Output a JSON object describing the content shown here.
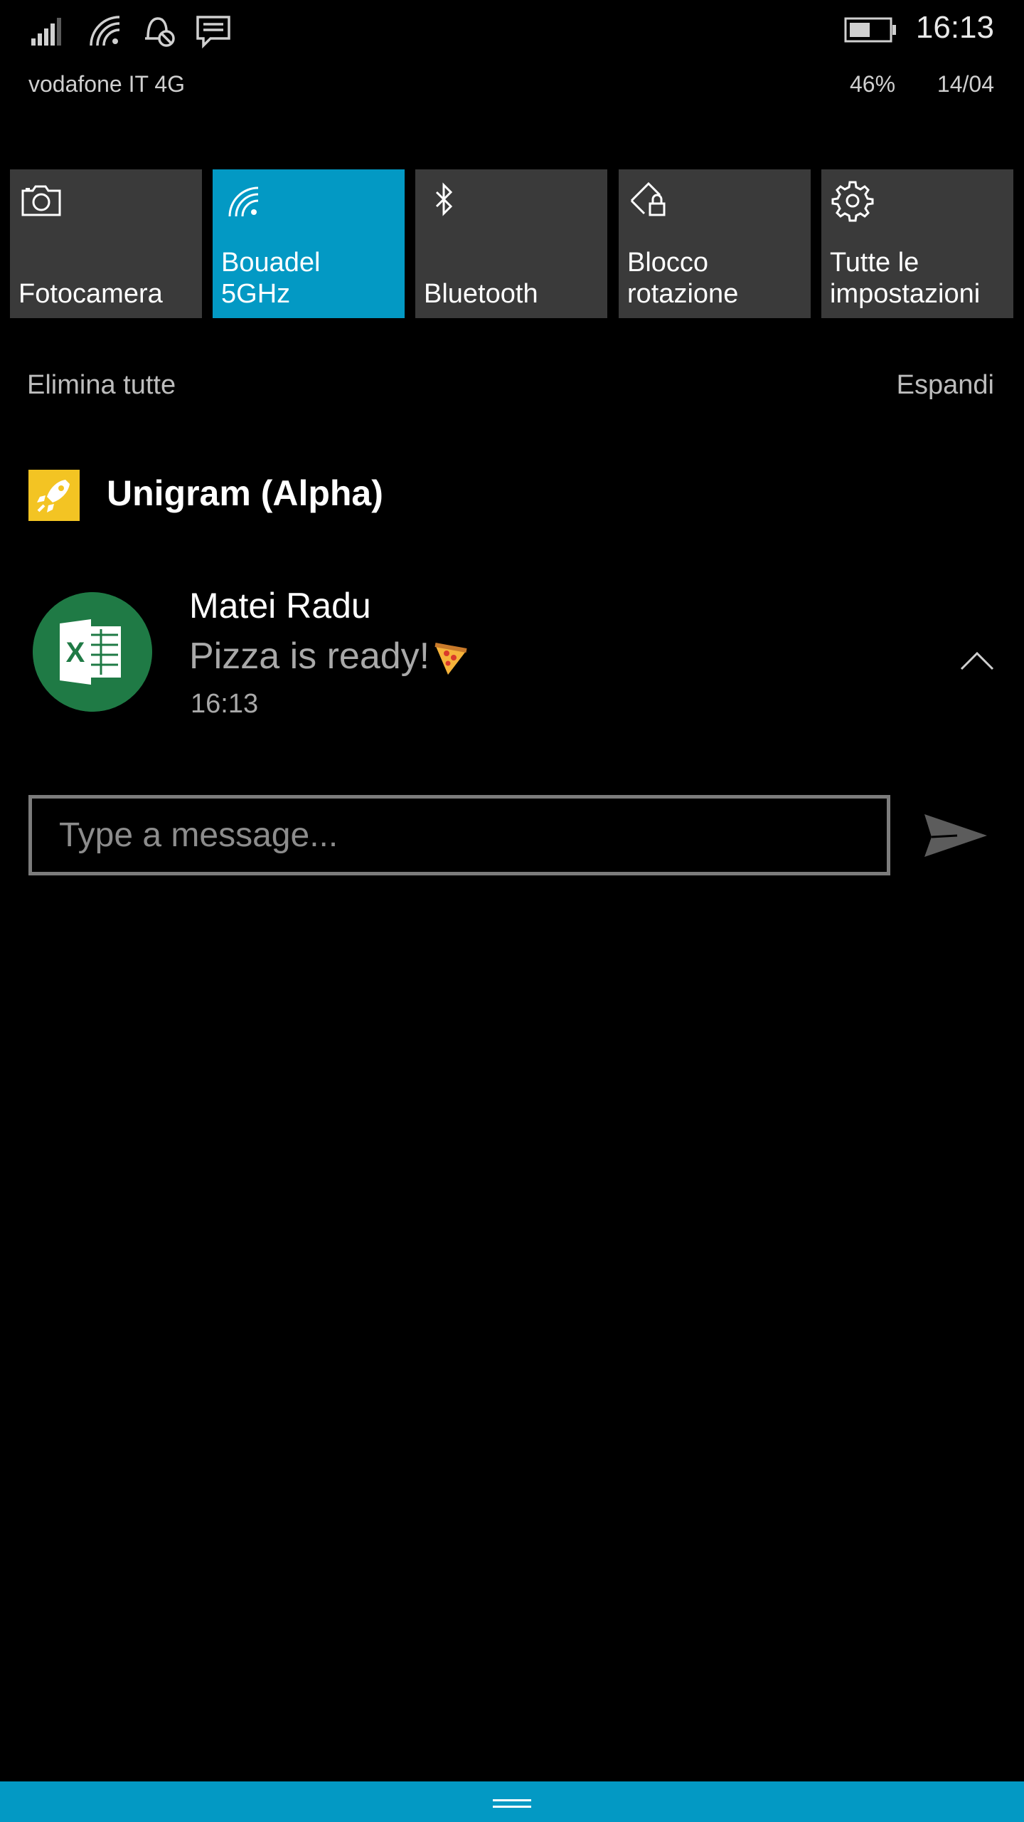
{
  "status_bar": {
    "icons": [
      "signal-icon",
      "wifi-icon",
      "quiet-hours-icon",
      "message-icon"
    ],
    "carrier": "vodafone IT  4G",
    "time": "16:13",
    "battery_percent": "46%",
    "date": "14/04"
  },
  "quick_actions": [
    {
      "icon": "camera-icon",
      "label": "Fotocamera",
      "active": false
    },
    {
      "icon": "wifi-icon",
      "label": "Bouadel\n5GHz",
      "active": true
    },
    {
      "icon": "bluetooth-icon",
      "label": "Bluetooth",
      "active": false
    },
    {
      "icon": "rotation-lock-icon",
      "label": "Blocco\nrotazione",
      "active": false
    },
    {
      "icon": "gear-icon",
      "label": "Tutte le\nimpostazioni",
      "active": false
    }
  ],
  "actions": {
    "clear_all": "Elimina tutte",
    "expand": "Espandi"
  },
  "app": {
    "name": "Unigram (Alpha)",
    "icon": "rocket-icon"
  },
  "notification": {
    "sender": "Matei Radu",
    "message": "Pizza is ready!",
    "emoji_icon": "pizza-icon",
    "time": "16:13",
    "avatar_icon": "excel-icon"
  },
  "reply": {
    "placeholder": "Type a message..."
  },
  "colors": {
    "accent": "#0399c4",
    "tile": "#3a3a3a",
    "app_icon_bg": "#f3c423",
    "avatar_bg": "#1f7a45"
  }
}
